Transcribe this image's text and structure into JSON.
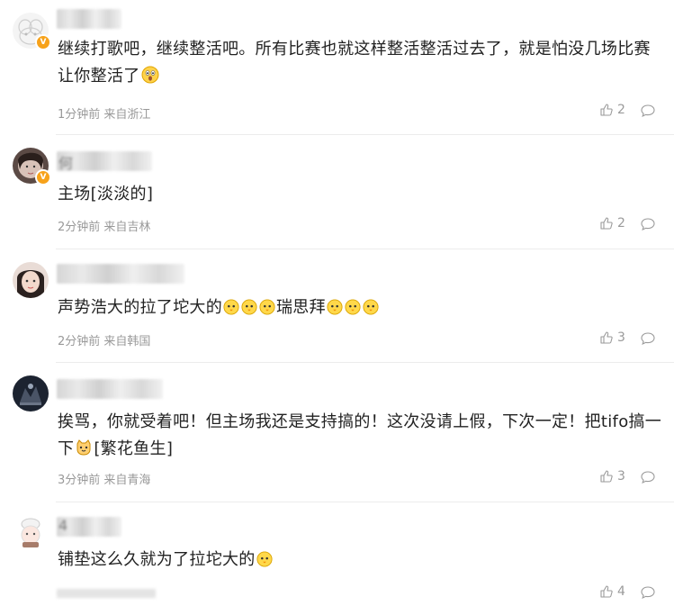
{
  "comments": [
    {
      "name": "",
      "text_parts": [
        "继续打歌吧，继续整活吧。所有比赛也就这样整活整活过去了，就是怕没几场比赛让你整活了"
      ],
      "emoji_after": [
        "surprise-emoji"
      ],
      "time": "1分钟前",
      "location": "来自浙江",
      "likes": "2",
      "verified": true
    },
    {
      "name": "何",
      "text_parts": [
        "主场[淡淡的]"
      ],
      "emoji_after": [],
      "time": "2分钟前",
      "location": "来自吉林",
      "likes": "2",
      "verified": true
    },
    {
      "name": "",
      "text_parts": [
        "声势浩大的拉了坨大的",
        "瑞思拜"
      ],
      "emoji_after": [
        "chick-emoji",
        "chick-emoji",
        "chick-emoji"
      ],
      "time": "2分钟前",
      "location": "来自韩国",
      "likes": "3",
      "verified": false
    },
    {
      "name": "",
      "text_parts": [
        "挨骂，你就受着吧！但主场我还是支持搞的！这次没请上假，下次一定！把tifo搞一下",
        "[繁花鱼生]"
      ],
      "emoji_after": [
        "cat-emoji"
      ],
      "time": "3分钟前",
      "location": "来自青海",
      "likes": "3",
      "verified": false
    },
    {
      "name": "4",
      "text_parts": [
        "铺垫这么久就为了拉坨大的"
      ],
      "emoji_after": [
        "chick-emoji"
      ],
      "time": "",
      "location": "",
      "likes": "4",
      "verified": false
    }
  ]
}
